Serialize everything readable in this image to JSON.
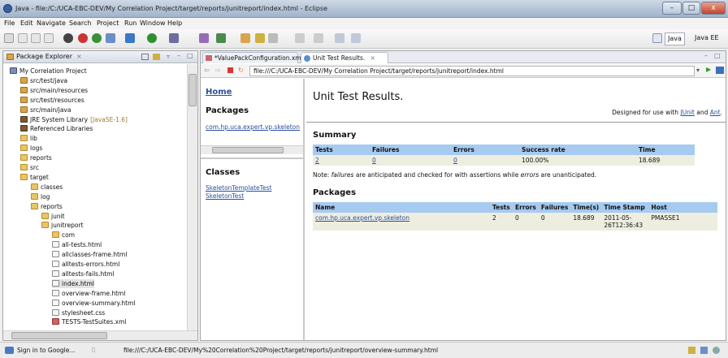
{
  "window": {
    "title": "Java - file:/C:/UCA-EBC-DEV/My Correlation Project/target/reports/junitreport/index.html - Eclipse",
    "minimize": "–",
    "maximize": "□",
    "close": "x"
  },
  "menu": [
    "File",
    "Edit",
    "Navigate",
    "Search",
    "Project",
    "Run",
    "Window",
    "Help"
  ],
  "perspectives": {
    "java": "Java",
    "javaee": "Java EE"
  },
  "package_explorer": {
    "tab_label": "Package Explorer",
    "tree": [
      {
        "label": "My Correlation Project",
        "icon": "proj",
        "depth": 0
      },
      {
        "label": "src/test/java",
        "icon": "pkg",
        "depth": 1
      },
      {
        "label": "src/main/resources",
        "icon": "pkg",
        "depth": 1
      },
      {
        "label": "src/test/resources",
        "icon": "pkg",
        "depth": 1
      },
      {
        "label": "src/main/java",
        "icon": "pkg",
        "depth": 1
      },
      {
        "label": "JRE System Library",
        "extra": "[JavaSE-1.6]",
        "icon": "jar",
        "depth": 1
      },
      {
        "label": "Referenced Libraries",
        "icon": "jar",
        "depth": 1
      },
      {
        "label": "lib",
        "icon": "folder",
        "depth": 1
      },
      {
        "label": "logs",
        "icon": "folder",
        "depth": 1
      },
      {
        "label": "reports",
        "icon": "folder",
        "depth": 1
      },
      {
        "label": "src",
        "icon": "folder",
        "depth": 1
      },
      {
        "label": "target",
        "icon": "folder",
        "depth": 1
      },
      {
        "label": "classes",
        "icon": "folder",
        "depth": 2
      },
      {
        "label": "log",
        "icon": "folder",
        "depth": 2
      },
      {
        "label": "reports",
        "icon": "folder",
        "depth": 2
      },
      {
        "label": "junit",
        "icon": "folder",
        "depth": 3
      },
      {
        "label": "junitreport",
        "icon": "folder",
        "depth": 3
      },
      {
        "label": "com",
        "icon": "folder",
        "depth": 4
      },
      {
        "label": "all-tests.html",
        "icon": "file",
        "depth": 4
      },
      {
        "label": "allclasses-frame.html",
        "icon": "file",
        "depth": 4
      },
      {
        "label": "alltests-errors.html",
        "icon": "file",
        "depth": 4
      },
      {
        "label": "alltests-fails.html",
        "icon": "file",
        "depth": 4
      },
      {
        "label": "index.html",
        "icon": "file",
        "depth": 4
      },
      {
        "label": "overview-frame.html",
        "icon": "file",
        "depth": 4
      },
      {
        "label": "overview-summary.html",
        "icon": "file",
        "depth": 4
      },
      {
        "label": "stylesheet.css",
        "icon": "file",
        "depth": 4
      },
      {
        "label": "TESTS-TestSuites.xml",
        "icon": "xml",
        "depth": 4
      }
    ]
  },
  "editor_tabs": [
    {
      "label": "*ValuePackConfiguration.xml",
      "active": false
    },
    {
      "label": "Unit Test Results.",
      "active": true
    }
  ],
  "address": {
    "url": "file:///C:/UCA-EBC-DEV/My Correlation Project/target/reports/junitreport/index.html"
  },
  "report": {
    "nav_home": "Home",
    "nav_packages_heading": "Packages",
    "nav_package_link": "com.hp.uca.expert.vp.skeleton",
    "nav_classes_heading": "Classes",
    "classes": [
      "SkeletonTemplateTest",
      "SkeletonTest"
    ],
    "title": "Unit Test Results.",
    "designed_prefix": "Designed for use with",
    "designed_junit": "JUnit",
    "designed_and": "and",
    "designed_ant": "Ant",
    "designed_suffix": ".",
    "summary_heading": "Summary",
    "summary_headers": [
      "Tests",
      "Failures",
      "Errors",
      "Success rate",
      "Time"
    ],
    "summary_values": {
      "tests": "2",
      "failures": "0",
      "errors": "0",
      "success_rate": "100.00%",
      "time": "18.689"
    },
    "note_prefix": "Note: ",
    "note_failures": "failures",
    "note_middle": " are anticipated and checked for with assertions while ",
    "note_errors": "errors",
    "note_suffix": " are unanticipated.",
    "packages_heading": "Packages",
    "packages_headers": [
      "Name",
      "Tests",
      "Errors",
      "Failures",
      "Time(s)",
      "Time Stamp",
      "Host"
    ],
    "packages_row": {
      "name": "com.hp.uca.expert.vp.skeleton",
      "tests": "2",
      "errors": "0",
      "failures": "0",
      "time": "18.689",
      "stamp_date": "2011-05-",
      "stamp_time": "26T12:36:43",
      "host": "PMASSE1"
    }
  },
  "status": {
    "sign_in": "Sign in to Google...",
    "url": "file:///C:/UCA-EBC-DEV/My%20Correlation%20Project/target/reports/junitreport/overview-summary.html"
  },
  "colors": {
    "table_header": "#a6caf0",
    "table_cell": "#eeeee0",
    "link": "#2a4d9c"
  }
}
